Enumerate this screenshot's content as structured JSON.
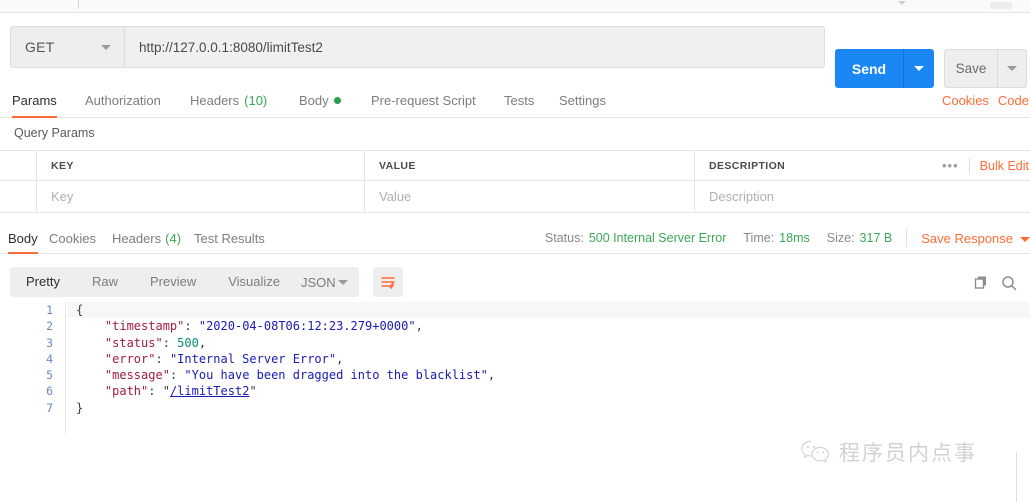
{
  "request": {
    "method": "GET",
    "url": "http://127.0.0.1:8080/limitTest2",
    "send_label": "Send",
    "save_label": "Save",
    "tabs": [
      {
        "label": "Params",
        "active": true
      },
      {
        "label": "Authorization",
        "active": false
      },
      {
        "label": "Headers",
        "count": "(10)",
        "active": false
      },
      {
        "label": "Body",
        "dot": true,
        "active": false
      },
      {
        "label": "Pre-request Script",
        "active": false
      },
      {
        "label": "Tests",
        "active": false
      },
      {
        "label": "Settings",
        "active": false
      }
    ],
    "links": [
      "Cookies",
      "Code"
    ]
  },
  "params": {
    "section_title": "Query Params",
    "headers": [
      "KEY",
      "VALUE",
      "DESCRIPTION"
    ],
    "placeholders": [
      "Key",
      "Value",
      "Description"
    ],
    "bulk_edit_label": "Bulk Edit",
    "more_label": "•••"
  },
  "response": {
    "tabs": [
      {
        "label": "Body",
        "active": true
      },
      {
        "label": "Cookies",
        "active": false
      },
      {
        "label": "Headers",
        "count": "(4)",
        "active": false
      },
      {
        "label": "Test Results",
        "active": false
      }
    ],
    "status_label": "Status:",
    "status_value": "500 Internal Server Error",
    "time_label": "Time:",
    "time_value": "18ms",
    "size_label": "Size:",
    "size_value": "317 B",
    "save_response_label": "Save Response",
    "view_modes": [
      {
        "label": "Pretty",
        "active": true
      },
      {
        "label": "Raw",
        "active": false
      },
      {
        "label": "Preview",
        "active": false
      },
      {
        "label": "Visualize",
        "active": false
      }
    ],
    "format": "JSON",
    "line_numbers": [
      "1",
      "2",
      "3",
      "4",
      "5",
      "6",
      "7"
    ],
    "body_json": {
      "timestamp": "2020-04-08T06:12:23.279+0000",
      "status": 500,
      "error": "Internal Server Error",
      "message": "You have been dragged into the blacklist",
      "path": "/limitTest2"
    },
    "body_lines": [
      "{",
      "    \"timestamp\": \"2020-04-08T06:12:23.279+0000\",",
      "    \"status\": 500,",
      "    \"error\": \"Internal Server Error\",",
      "    \"message\": \"You have been dragged into the blacklist\",",
      "    \"path\": \"/limitTest2\"",
      "}"
    ]
  },
  "watermark": {
    "text": "程序员内点事"
  },
  "colors": {
    "accent": "#ff6c37",
    "send_blue": "#1a87f5",
    "status_green": "#3aa757",
    "json_key": "#a11c3e",
    "json_string": "#1a1ab5",
    "json_number": "#0f8a7a"
  }
}
